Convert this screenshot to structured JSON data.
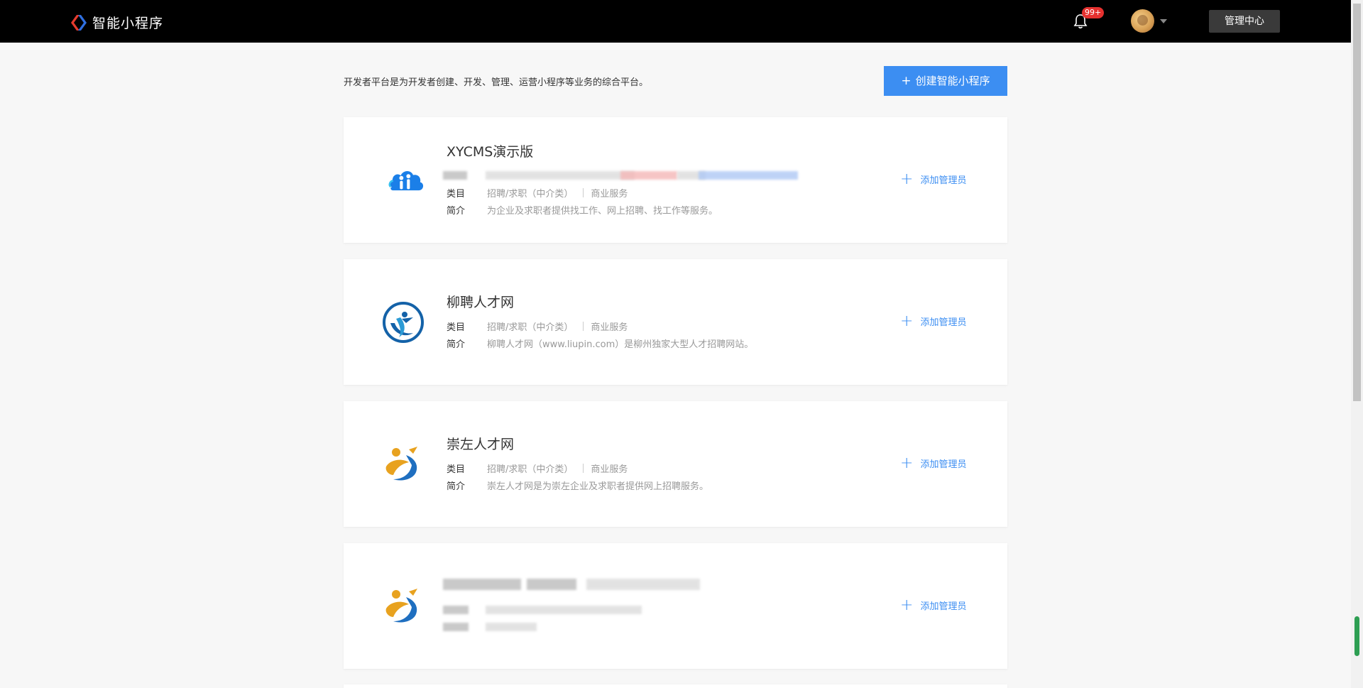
{
  "header": {
    "app_title": "智能小程序",
    "notification_badge": "99+",
    "admin_center_label": "管理中心"
  },
  "intro": {
    "description": "开发者平台是为开发者创建、开发、管理、运营小程序等业务的综合平台。",
    "create_button_label": "创建智能小程序"
  },
  "labels": {
    "category": "类目",
    "intro": "简介",
    "add_admin": "添加管理员"
  },
  "apps": [
    {
      "name": "XYCMS演示版",
      "category": "招聘/求职（中介类）",
      "service": "商业服务",
      "intro": "为企业及求职者提供找工作、网上招聘、找工作等服务。"
    },
    {
      "name": "柳聘人才网",
      "category": "招聘/求职（中介类）",
      "service": "商业服务",
      "intro": "柳聘人才网（www.liupin.com）是柳州独家大型人才招聘网站。"
    },
    {
      "name": "崇左人才网",
      "category": "招聘/求职（中介类）",
      "service": "商业服务",
      "intro": "崇左人才网是为崇左企业及求职者提供网上招聘服务。"
    }
  ],
  "colors": {
    "accent": "#3c8ef2",
    "topbar": "#000000",
    "badge": "#e6312f"
  },
  "icons": {
    "logo": "brand-logo-icon",
    "bell": "bell-icon",
    "plus": "plus-icon",
    "caret": "caret-down-icon"
  }
}
